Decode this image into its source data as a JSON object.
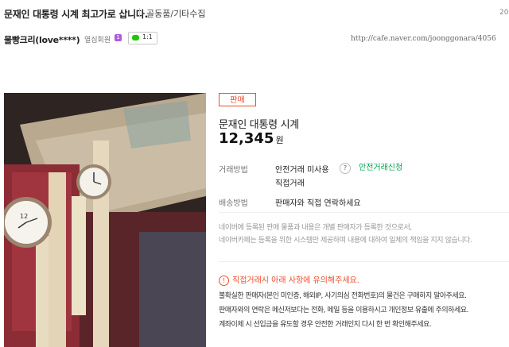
{
  "header": {
    "title": "문재인 대통령 시계 최고가로 삽니다.",
    "board": "골동품/기타수집",
    "date": "20"
  },
  "writer": {
    "nickname": "물빵크리(love****)",
    "level": "열심회원",
    "level_badge": "1",
    "chat_count": "1:1",
    "url": "http://cafe.naver.com/joonggonara/4056"
  },
  "product": {
    "badge": "판매",
    "name": "문재인 대통령 시계",
    "price": "12,345",
    "currency": "원",
    "trade_label": "거래방법",
    "trade_value": "안전거래 미사용",
    "trade_help": "?",
    "trade_link": "안전거래신청",
    "trade_direct": "직접거래",
    "delivery_label": "배송방법",
    "delivery_value": "판매자와 직접 연락하세요"
  },
  "notice": {
    "line1": "네이버에 등록된 판매 물품과 내용은 개별 판매자가 등록한 것으로서,",
    "line2": "네이버카페는 등록을 위한 시스템만 제공하며 내용에 대하여 일체의 책임을 지지 않습니다."
  },
  "warning": {
    "icon": "!",
    "title": "직접거래시 아래 사항에 유의해주세요.",
    "items": [
      "불확실한 판매자(본인 미인증, 해외IP, 사기의심 전화번호)의 물건은 구매하지 말아주세요.",
      "판매자와의 연락은 메신저보다는 전화, 메일 등을 이용하시고 개인정보 유출에 주의하세요.",
      "계좌이체 시 선입금을 유도할 경우 안전한 거래인지 다시 한 번 확인해주세요."
    ]
  },
  "colors": {
    "accent": "#f04c2a",
    "link_green": "#00a54c",
    "level_badge": "#b05ae0",
    "chat_icon": "#1ec800"
  }
}
